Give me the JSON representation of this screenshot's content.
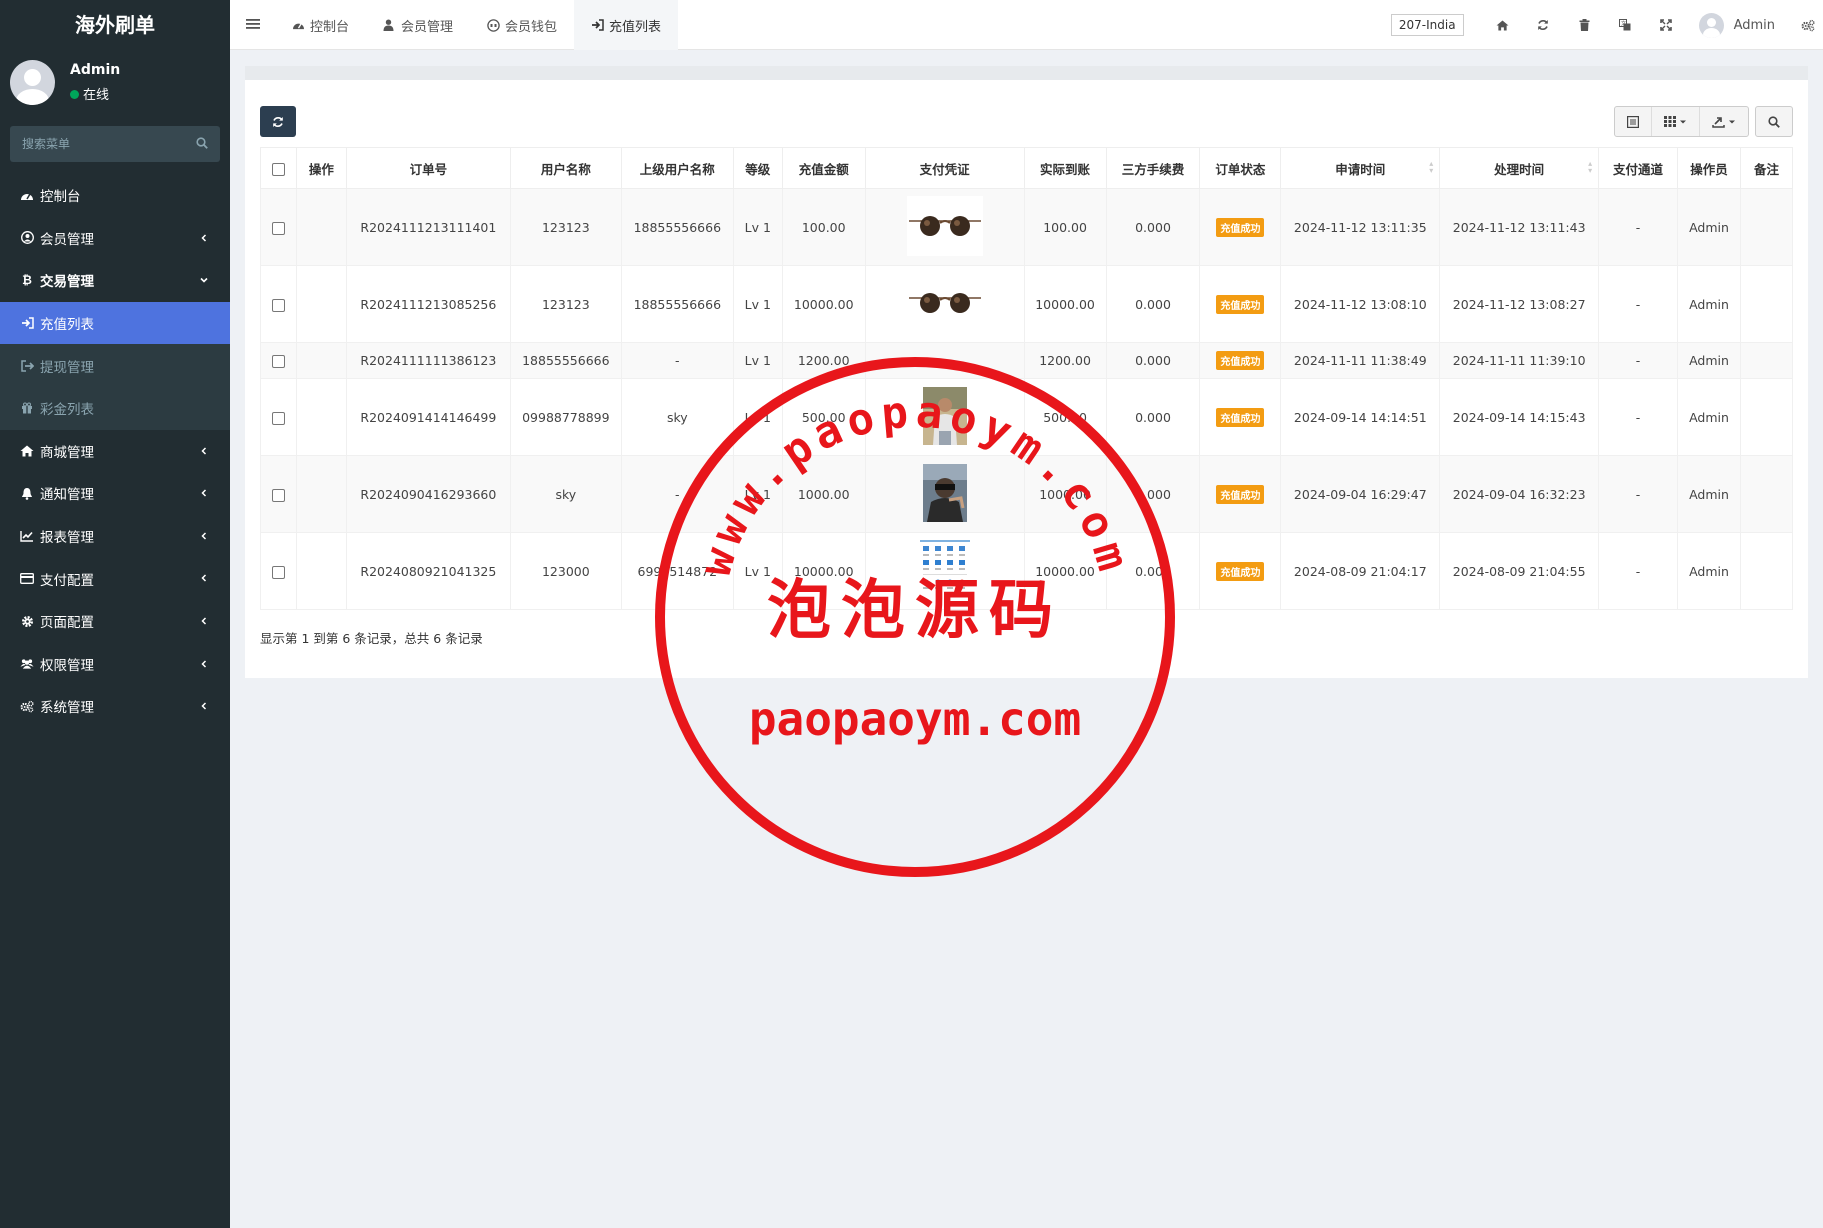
{
  "app": {
    "title": "海外刷单"
  },
  "user": {
    "name": "Admin",
    "status": "在线"
  },
  "sidebar": {
    "search_placeholder": "搜索菜单",
    "items": [
      {
        "label": "控制台",
        "icon": "dashboard-icon"
      },
      {
        "label": "会员管理",
        "icon": "user-circle-icon"
      },
      {
        "label": "交易管理",
        "icon": "bitcoin-icon"
      },
      {
        "label": "充值列表",
        "icon": "sign-in-icon"
      },
      {
        "label": "提现管理",
        "icon": "sign-out-icon"
      },
      {
        "label": "彩金列表",
        "icon": "gift-icon"
      },
      {
        "label": "商城管理",
        "icon": "home-icon"
      },
      {
        "label": "通知管理",
        "icon": "bell-icon"
      },
      {
        "label": "报表管理",
        "icon": "line-chart-icon"
      },
      {
        "label": "支付配置",
        "icon": "credit-card-icon"
      },
      {
        "label": "页面配置",
        "icon": "cog-icon"
      },
      {
        "label": "权限管理",
        "icon": "users-icon"
      },
      {
        "label": "系统管理",
        "icon": "cogs-icon"
      }
    ]
  },
  "topbar": {
    "tabs": [
      {
        "label": "控制台",
        "icon": "dashboard-icon"
      },
      {
        "label": "会员管理",
        "icon": "user-icon"
      },
      {
        "label": "会员钱包",
        "icon": "wallet-icon"
      },
      {
        "label": "充值列表",
        "icon": "sign-in-icon"
      }
    ],
    "region": "207-India",
    "user": "Admin"
  },
  "table": {
    "headers": {
      "op": "操作",
      "order_no": "订单号",
      "username": "用户名称",
      "parent": "上级用户名称",
      "level": "等级",
      "amount": "充值金额",
      "proof": "支付凭证",
      "arrived": "实际到账",
      "fee": "三方手续费",
      "status": "订单状态",
      "apply_time": "申请时间",
      "process_time": "处理时间",
      "channel": "支付通道",
      "operator": "操作员",
      "remark": "备注"
    },
    "rows": [
      {
        "order_no": "R2024111213111401",
        "username": "123123",
        "parent": "18855556666",
        "level": "Lv 1",
        "amount": "100.00",
        "proof": "sunglasses-photo",
        "arrived": "100.00",
        "fee": "0.000",
        "status": "充值成功",
        "apply_time": "2024-11-12 13:11:35",
        "process_time": "2024-11-12 13:11:43",
        "channel": "-",
        "operator": "Admin",
        "remark": ""
      },
      {
        "order_no": "R2024111213085256",
        "username": "123123",
        "parent": "18855556666",
        "level": "Lv 1",
        "amount": "10000.00",
        "proof": "sunglasses-photo",
        "arrived": "10000.00",
        "fee": "0.000",
        "status": "充值成功",
        "apply_time": "2024-11-12 13:08:10",
        "process_time": "2024-11-12 13:08:27",
        "channel": "-",
        "operator": "Admin",
        "remark": ""
      },
      {
        "order_no": "R2024111111386123",
        "username": "18855556666",
        "parent": "-",
        "level": "Lv 1",
        "amount": "1200.00",
        "proof": "",
        "arrived": "1200.00",
        "fee": "0.000",
        "status": "充值成功",
        "apply_time": "2024-11-11 11:38:49",
        "process_time": "2024-11-11 11:39:10",
        "channel": "-",
        "operator": "Admin",
        "remark": ""
      },
      {
        "order_no": "R2024091414146499",
        "username": "09988778899",
        "parent": "sky",
        "level": "Lv 1",
        "amount": "500.00",
        "proof": "person-photo",
        "arrived": "500.00",
        "fee": "0.000",
        "status": "充值成功",
        "apply_time": "2024-09-14 14:14:51",
        "process_time": "2024-09-14 14:15:43",
        "channel": "-",
        "operator": "Admin",
        "remark": ""
      },
      {
        "order_no": "R2024090416293660",
        "username": "sky",
        "parent": "-",
        "level": "Lv 1",
        "amount": "1000.00",
        "proof": "selfie-photo",
        "arrived": "1000.00",
        "fee": "0.000",
        "status": "充值成功",
        "apply_time": "2024-09-04 16:29:47",
        "process_time": "2024-09-04 16:32:23",
        "channel": "-",
        "operator": "Admin",
        "remark": ""
      },
      {
        "order_no": "R2024080921041325",
        "username": "123000",
        "parent": "6999514872",
        "level": "Lv 1",
        "amount": "10000.00",
        "proof": "app-screenshot",
        "arrived": "10000.00",
        "fee": "0.000",
        "status": "充值成功",
        "apply_time": "2024-08-09 21:04:17",
        "process_time": "2024-08-09 21:04:55",
        "channel": "-",
        "operator": "Admin",
        "remark": ""
      }
    ],
    "pager": "显示第 1 到第 6 条记录，总共 6 条记录"
  },
  "watermark": {
    "arc_text": "www.paopaoym.com",
    "center_text": "泡泡源码",
    "bottom_text": "paopaoym.com",
    "color": "#e8161b"
  }
}
